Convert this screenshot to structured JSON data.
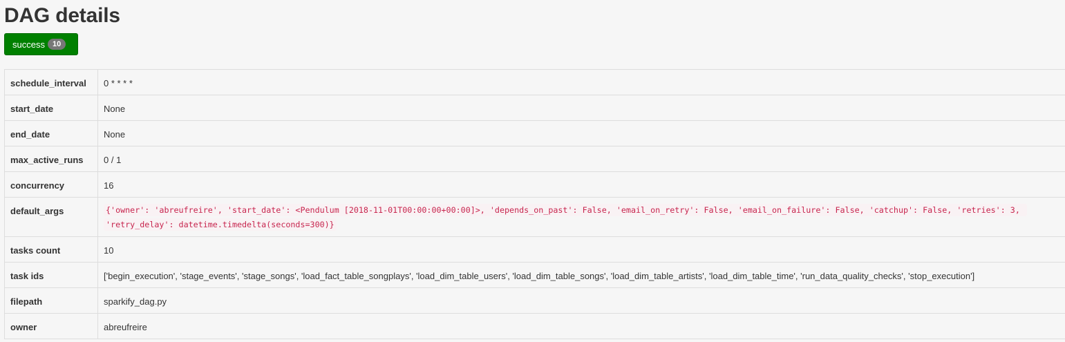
{
  "page": {
    "title": "DAG details"
  },
  "state": {
    "label": "success",
    "count": "10",
    "color": "#008000"
  },
  "details": [
    {
      "key": "schedule_interval",
      "value": "0 * * * *"
    },
    {
      "key": "start_date",
      "value": "None"
    },
    {
      "key": "end_date",
      "value": "None"
    },
    {
      "key": "max_active_runs",
      "value": "0 / 1"
    },
    {
      "key": "concurrency",
      "value": "16"
    },
    {
      "key": "default_args",
      "value": "{'owner': 'abreufreire', 'start_date': <Pendulum [2018-11-01T00:00:00+00:00]>, 'depends_on_past': False, 'email_on_retry': False, 'email_on_failure': False, 'catchup': False, 'retries': 3, 'retry_delay': datetime.timedelta(seconds=300)}"
    },
    {
      "key": "tasks count",
      "value": "10"
    },
    {
      "key": "task ids",
      "value": "['begin_execution', 'stage_events', 'stage_songs', 'load_fact_table_songplays', 'load_dim_table_users', 'load_dim_table_songs', 'load_dim_table_artists', 'load_dim_table_time', 'run_data_quality_checks', 'stop_execution']"
    },
    {
      "key": "filepath",
      "value": "sparkify_dag.py"
    },
    {
      "key": "owner",
      "value": "abreufreire"
    }
  ]
}
